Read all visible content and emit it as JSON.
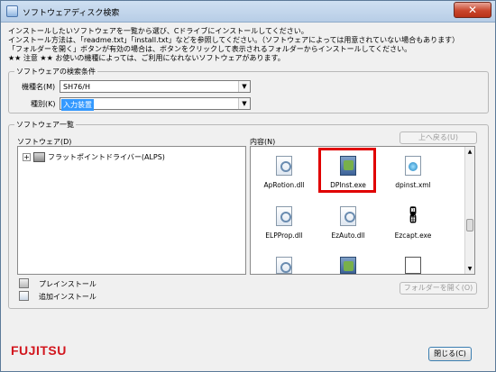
{
  "window": {
    "title": "ソフトウェアディスク検索",
    "close_label": "✕"
  },
  "intro": {
    "line1": "インストールしたいソフトウェアを一覧から選び、Cドライブにインストールしてください。",
    "line2": "インストール方法は、「readme.txt」「install.txt」などを参照してください。（ソフトウェアによっては用意されていない場合もあります）",
    "line3": "「フォルダーを開く」ボタンが有効の場合は、ボタンをクリックして表示されるフォルダーからインストールしてください。",
    "line4": "★★ 注意 ★★ お使いの機種によっては、ご利用になれないソフトウェアがあります。"
  },
  "search": {
    "legend": "ソフトウェアの検索条件",
    "model_label": "機種名(M)",
    "model_value": "SH76/H",
    "type_label": "種別(K)",
    "type_value": "入力装置"
  },
  "list": {
    "legend": "ソフトウェア一覧",
    "software_label": "ソフトウェア(D)",
    "contents_label": "内容(N)",
    "up_button": "上へ戻る(U)",
    "tree_item": "フラットポイントドライバー(ALPS)",
    "files": [
      {
        "name": "ApRotion.dll",
        "icon": "dll-file-icon"
      },
      {
        "name": "DPInst.exe",
        "icon": "exe-installer-icon"
      },
      {
        "name": "dpinst.xml",
        "icon": "xml-file-icon"
      },
      {
        "name": "ELPProp.dll",
        "icon": "dll-file-icon"
      },
      {
        "name": "EzAuto.dll",
        "icon": "dll-file-icon"
      },
      {
        "name": "Ezcapt.exe",
        "icon": "capture-exe-icon"
      }
    ],
    "open_folder_button": "フォルダーを開く(O)",
    "legend_preinstall": "プレインストール",
    "legend_additional": "追加インストール"
  },
  "footer": {
    "logo": "FUJITSU",
    "close_button": "閉じる(C)"
  },
  "colors": {
    "accent": "#3399ff",
    "highlight_box": "#e00000",
    "logo": "#d2161e"
  }
}
